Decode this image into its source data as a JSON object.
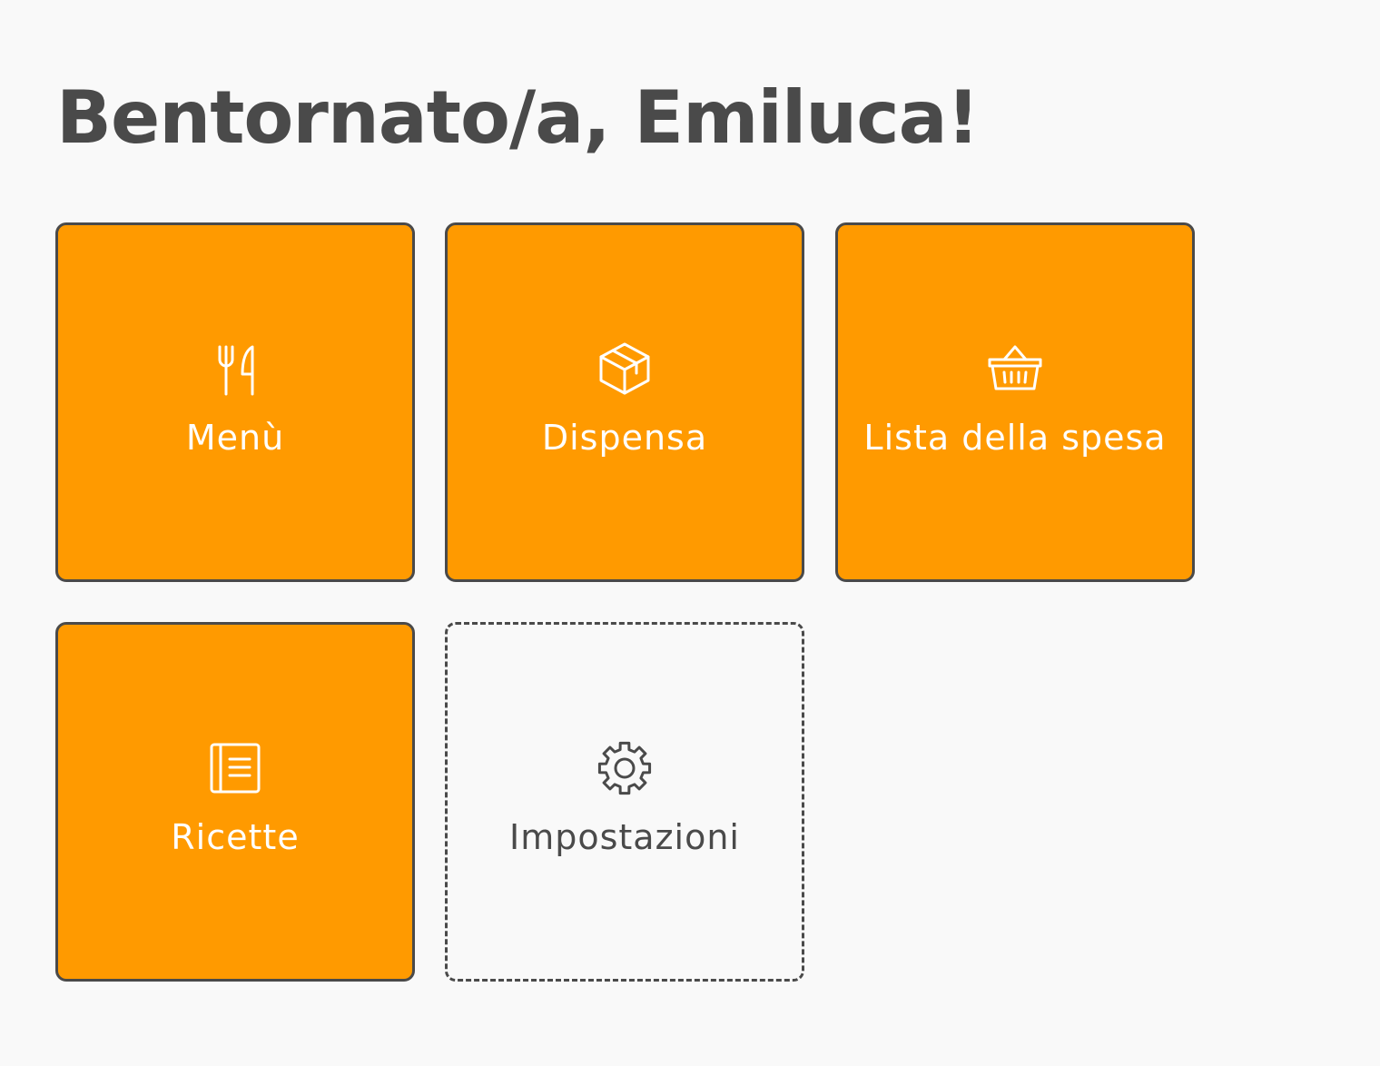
{
  "header": {
    "title": "Bentornato/a, Emiluca!"
  },
  "tiles": [
    {
      "label": "Menù",
      "icon": "fork-knife-icon",
      "style": "primary"
    },
    {
      "label": "Dispensa",
      "icon": "box-icon",
      "style": "primary"
    },
    {
      "label": "Lista della spesa",
      "icon": "basket-icon",
      "style": "primary"
    },
    {
      "label": "Ricette",
      "icon": "recipe-book-icon",
      "style": "primary"
    },
    {
      "label": "Impostazioni",
      "icon": "gear-icon",
      "style": "dashed"
    }
  ],
  "colors": {
    "background": "#f9f9f9",
    "accent": "#ff9a00",
    "border": "#4a4a4a",
    "tile_text": "#ffffff",
    "title_text": "#4a4a4a"
  }
}
